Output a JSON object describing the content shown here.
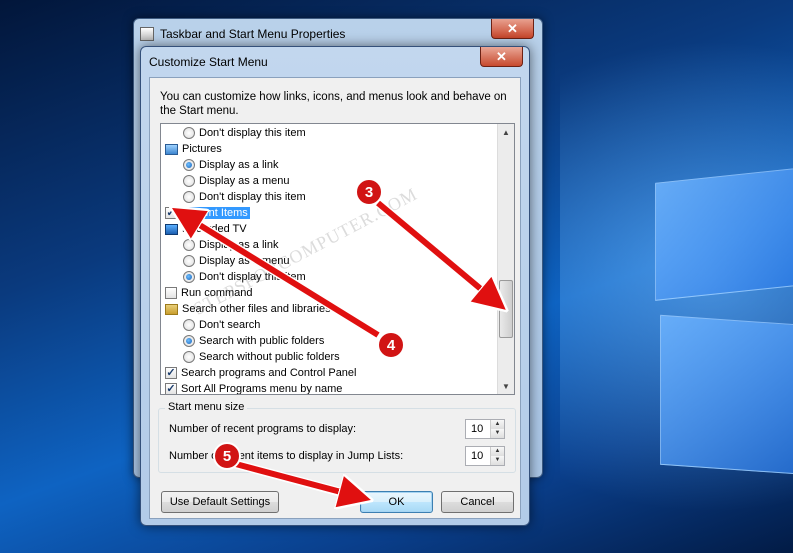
{
  "outer_window": {
    "title": "Taskbar and Start Menu Properties",
    "close": "✕"
  },
  "dialog": {
    "title": "Customize Start Menu",
    "close": "✕",
    "description": "You can customize how links, icons, and menus look and behave on the Start menu."
  },
  "list": {
    "items": [
      {
        "type": "radio",
        "checked": false,
        "label": "Don't display this item"
      },
      {
        "type": "header",
        "icon": "pictures-icon",
        "label": "Pictures"
      },
      {
        "type": "radio",
        "checked": true,
        "label": "Display as a link"
      },
      {
        "type": "radio",
        "checked": false,
        "label": "Display as a menu"
      },
      {
        "type": "radio",
        "checked": false,
        "label": "Don't display this item"
      },
      {
        "type": "check",
        "checked": true,
        "label": "Recent Items",
        "selected": true
      },
      {
        "type": "header",
        "icon": "tv-icon",
        "label": "Recorded TV"
      },
      {
        "type": "radio",
        "checked": false,
        "label": "Display as a link"
      },
      {
        "type": "radio",
        "checked": false,
        "label": "Display as a menu"
      },
      {
        "type": "radio",
        "checked": true,
        "label": "Don't display this item"
      },
      {
        "type": "check",
        "checked": false,
        "label": "Run command"
      },
      {
        "type": "header",
        "icon": "folder-icon",
        "label": "Search other files and libraries"
      },
      {
        "type": "radio",
        "checked": false,
        "label": "Don't search"
      },
      {
        "type": "radio",
        "checked": true,
        "label": "Search with public folders"
      },
      {
        "type": "radio",
        "checked": false,
        "label": "Search without public folders"
      },
      {
        "type": "check",
        "checked": true,
        "label": "Search programs and Control Panel"
      },
      {
        "type": "check",
        "checked": true,
        "label": "Sort All Programs menu by name"
      }
    ]
  },
  "start_menu_size": {
    "title": "Start menu size",
    "recent_programs_label": "Number of recent programs to display:",
    "recent_programs_value": "10",
    "jump_list_label": "Number of recent items to display in Jump Lists:",
    "jump_list_value": "10"
  },
  "buttons": {
    "default_settings": "Use Default Settings",
    "ok": "OK",
    "cancel": "Cancel"
  },
  "annotations": {
    "badge_3": "3",
    "badge_4": "4",
    "badge_5": "5",
    "arrow_color": "#e01010",
    "watermark": "STEPSFORCOMPUTER.COM"
  }
}
